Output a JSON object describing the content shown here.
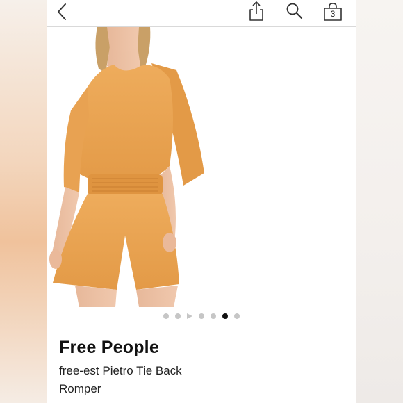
{
  "header": {
    "icons": [
      "back-chevron-icon",
      "share-icon",
      "search-icon",
      "shopping-bag-icon"
    ],
    "bag_count": "3"
  },
  "gallery": {
    "image_description": "product-photo-orange-romper",
    "slide_count": 7,
    "active_index": 5,
    "video_slide_index": 2
  },
  "product": {
    "brand": "Free People",
    "name": "free-est Pietro Tie Back Romper"
  },
  "colors": {
    "romper": "#e9a250",
    "active_dot": "#111111",
    "inactive_dot": "#c6c6c6"
  }
}
